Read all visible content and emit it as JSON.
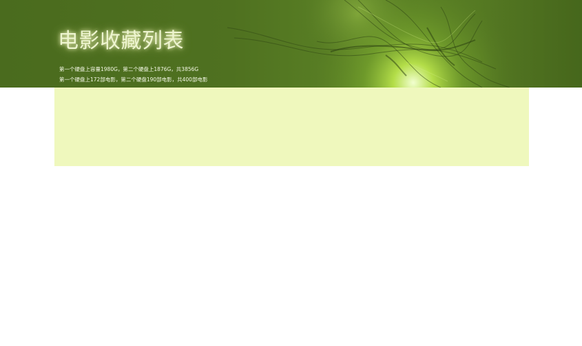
{
  "header": {
    "title": "电影收藏列表",
    "info_line_1": "第一个硬盘上容量1980G，第二个硬盘上1876G，共3856G",
    "info_line_2": "第一个硬盘上172部电影，第二个硬盘190部电影，共400部电影"
  },
  "content": {
    "panel_color": "#eff8bd"
  },
  "colors": {
    "banner_green": "#4f7120",
    "highlight_green": "#b5e04a",
    "title_text": "#eef5d0"
  }
}
